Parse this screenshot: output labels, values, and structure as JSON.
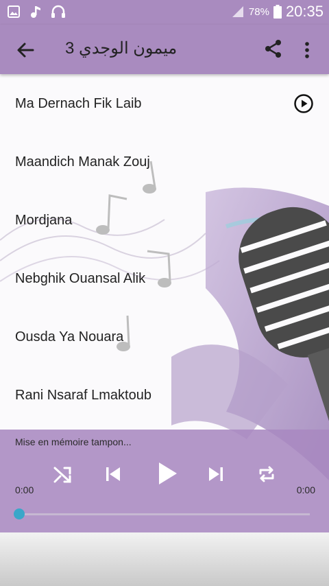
{
  "status_bar": {
    "icons": [
      "image-icon",
      "music-note-icon",
      "headphones-icon",
      "signal-icon",
      "battery-icon"
    ],
    "battery": "78%",
    "time": "20:35"
  },
  "app_bar": {
    "title": "ميمون الوجدي 3",
    "back_icon": "arrow-back-icon",
    "share_icon": "share-icon",
    "more_icon": "more-vert-icon"
  },
  "songs": [
    {
      "title": "Ma Dernach Fik Laib",
      "has_play_button": true
    },
    {
      "title": "Maandich Manak Zouj"
    },
    {
      "title": "Mordjana"
    },
    {
      "title": "Nebghik Ouansal Alik"
    },
    {
      "title": "Ousda Ya Nouara"
    },
    {
      "title": "Rani Nsaraf Lmaktoub"
    }
  ],
  "player": {
    "status": "Mise en mémoire tampon...",
    "elapsed": "0:00",
    "duration": "0:00",
    "progress": 0,
    "controls": [
      "shuffle-icon",
      "skip-previous-icon",
      "play-icon",
      "skip-next-icon",
      "repeat-icon"
    ]
  },
  "colors": {
    "accent": "#a98bbf",
    "seek_thumb": "#3aa7c9",
    "text": "#222222"
  }
}
